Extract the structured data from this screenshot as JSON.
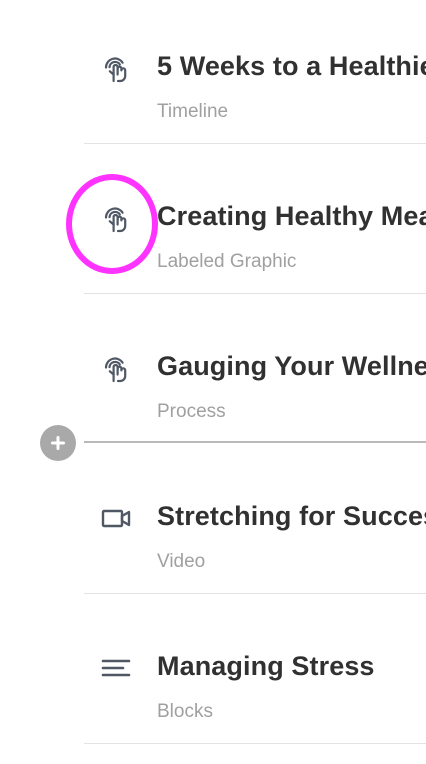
{
  "lessons": [
    {
      "title": "5 Weeks to a Healthie",
      "type": "Timeline",
      "icon": "interactive-hand-icon"
    },
    {
      "title": "Creating Healthy Mea",
      "type": "Labeled Graphic",
      "icon": "interactive-hand-icon"
    },
    {
      "title": "Gauging Your Wellne",
      "type": "Process",
      "icon": "interactive-hand-icon"
    },
    {
      "title": "Stretching for Succes",
      "type": "Video",
      "icon": "video-camera-icon"
    },
    {
      "title": "Managing Stress",
      "type": "Blocks",
      "icon": "text-lines-icon"
    }
  ],
  "add_button": {
    "icon": "plus-icon"
  },
  "colors": {
    "title": "#313131",
    "subtitle": "#a0a0a0",
    "icon": "#505866",
    "divider": "#e3e3e3",
    "add_button": "#a9a9a9",
    "highlight": "#ff33ff"
  }
}
